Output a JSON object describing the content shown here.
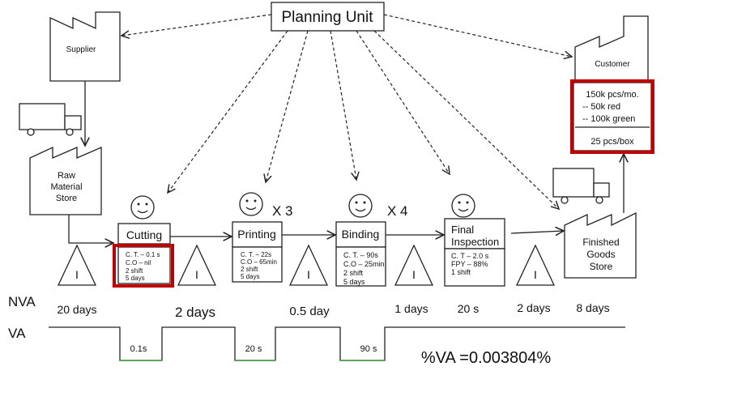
{
  "planning_unit": "Planning Unit",
  "supplier": "Supplier",
  "customer": {
    "label": "Customer",
    "demand": [
      "150k pcs/mo.",
      "--  50k red",
      "-- 100k green"
    ],
    "packaging": "25 pcs/box"
  },
  "raw_material_store": [
    "Raw",
    "Material",
    "Store"
  ],
  "finished_goods_store": [
    "Finished",
    "Goods",
    "Store"
  ],
  "processes": [
    {
      "name": [
        "Cutting"
      ],
      "operators": "",
      "data": [
        "C. T. – 0.1 s",
        "C.O – nil",
        "2 shift",
        "5 days"
      ]
    },
    {
      "name": [
        "Printing"
      ],
      "operators": "X 3",
      "data": [
        "C. T. – 22s",
        "C.O – 65min",
        "2 shift",
        "5 days"
      ]
    },
    {
      "name": [
        "Binding"
      ],
      "operators": "X 4",
      "data": [
        "C. T. – 90s",
        "C.O – 25min",
        "2 shift",
        "5 days"
      ]
    },
    {
      "name": [
        "Final",
        "Inspection"
      ],
      "operators": "",
      "data": [
        "C. T – 2.0 s",
        "FPY – 88%",
        "1 shift"
      ]
    }
  ],
  "inventory_label": "I",
  "timeline": {
    "nva_label": "NVA",
    "va_label": "VA",
    "nva_values": [
      "20 days",
      "2 days",
      "0.5 day",
      "1 days",
      "20 s",
      "2 days",
      "8 days"
    ],
    "va_values": [
      "0.1s",
      "20 s",
      "90 s"
    ],
    "va_percent": "%VA =0.003804%"
  },
  "colors": {
    "highlight": "#c00000",
    "va_line": "#3a9a3a"
  }
}
